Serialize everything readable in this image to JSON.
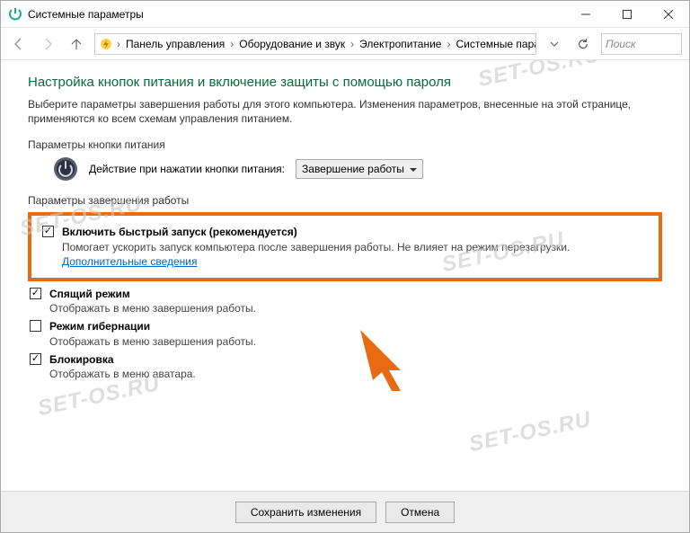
{
  "window": {
    "title": "Системные параметры"
  },
  "breadcrumb": {
    "items": [
      "Панель управления",
      "Оборудование и звук",
      "Электропитание",
      "Системные параметры"
    ]
  },
  "search": {
    "placeholder": "Поиск"
  },
  "heading": "Настройка кнопок питания и включение защиты с помощью пароля",
  "intro": "Выберите параметры завершения работы для этого компьютера. Изменения параметров, внесенные на этой странице, применяются ко всем схемам управления питанием.",
  "section_power_button": "Параметры кнопки питания",
  "power_button": {
    "label": "Действие при нажатии кнопки питания:",
    "value": "Завершение работы"
  },
  "section_shutdown": "Параметры завершения работы",
  "fast_startup": {
    "title": "Включить быстрый запуск (рекомендуется)",
    "desc": "Помогает ускорить запуск компьютера после завершения работы. Не влияет на режим перезагрузки.",
    "link": "Дополнительные сведения",
    "checked": true
  },
  "sleep": {
    "title": "Спящий режим",
    "desc": "Отображать в меню завершения работы.",
    "checked": true
  },
  "hibernate": {
    "title": "Режим гибернации",
    "desc": "Отображать в меню завершения работы.",
    "checked": false
  },
  "lock": {
    "title": "Блокировка",
    "desc": "Отображать в меню аватара.",
    "checked": true
  },
  "buttons": {
    "save": "Сохранить изменения",
    "cancel": "Отмена"
  },
  "watermark": "SET-OS.RU"
}
